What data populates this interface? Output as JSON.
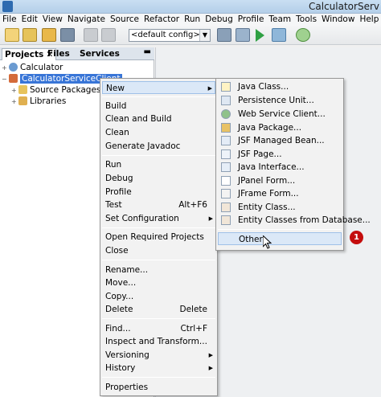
{
  "window": {
    "title": "CalculatorServ"
  },
  "menubar": [
    "File",
    "Edit",
    "View",
    "Navigate",
    "Source",
    "Refactor",
    "Run",
    "Debug",
    "Profile",
    "Team",
    "Tools",
    "Window",
    "Help"
  ],
  "toolbar": {
    "config": "<default config>"
  },
  "panel": {
    "tabs": [
      "Projects",
      "Files",
      "Services"
    ],
    "tree": {
      "calculator": "Calculator",
      "client": "CalculatorServiceClient",
      "source_packages": "Source Packages",
      "libraries": "Libraries"
    }
  },
  "context_menu": {
    "new": "New",
    "build": "Build",
    "clean_build": "Clean and Build",
    "clean": "Clean",
    "javadoc": "Generate Javadoc",
    "run": "Run",
    "debug": "Debug",
    "profile": "Profile",
    "test": "Test",
    "test_shortcut": "Alt+F6",
    "set_config": "Set Configuration",
    "open_required": "Open Required Projects",
    "close": "Close",
    "rename": "Rename...",
    "move": "Move...",
    "copy": "Copy...",
    "delete": "Delete",
    "delete_shortcut": "Delete",
    "find": "Find...",
    "find_shortcut": "Ctrl+F",
    "inspect": "Inspect and Transform...",
    "versioning": "Versioning",
    "history": "History",
    "properties": "Properties"
  },
  "new_submenu": [
    "Java Class...",
    "Persistence Unit...",
    "Web Service Client...",
    "Java Package...",
    "JSF Managed Bean...",
    "JSF Page...",
    "Java Interface...",
    "JPanel Form...",
    "JFrame Form...",
    "Entity Class...",
    "Entity Classes from Database...",
    "Other..."
  ],
  "callout": {
    "number": "1"
  },
  "colors": {
    "selection": "#3875d7",
    "highlight": "#dbe8f7",
    "badge": "#c40d0d"
  }
}
